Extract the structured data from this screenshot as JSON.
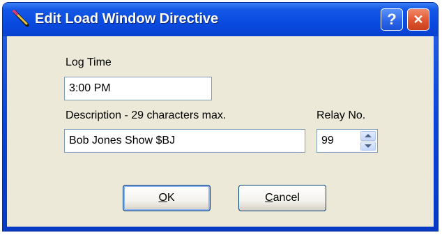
{
  "window": {
    "title": "Edit Load Window Directive",
    "help_glyph": "?",
    "close_glyph": "✕"
  },
  "form": {
    "log_time_label": "Log Time",
    "log_time_value": "3:00 PM",
    "description_label": "Description - 29 characters max.",
    "description_value": "Bob Jones Show $BJ",
    "relay_label": "Relay No.",
    "relay_value": "99"
  },
  "buttons": {
    "ok_mnemonic": "O",
    "ok_rest": "K",
    "cancel_mnemonic": "C",
    "cancel_rest": "ancel"
  },
  "icons": {
    "app": "pencil-icon",
    "help": "help-icon",
    "close": "close-icon",
    "spin_up": "arrow-up-icon",
    "spin_down": "arrow-down-icon"
  },
  "colors": {
    "titlebar": "#0a4ae0",
    "client_bg": "#ece9d8",
    "close_button": "#e05530",
    "input_border": "#7f9db9"
  }
}
